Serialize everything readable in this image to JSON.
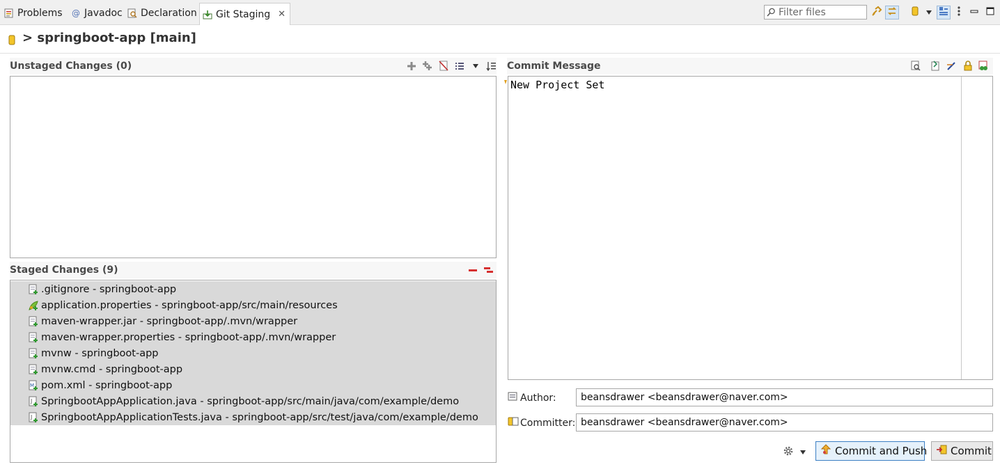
{
  "tabs": [
    {
      "label": "Problems",
      "icon": "problems-icon"
    },
    {
      "label": "Javadoc",
      "icon": "javadoc-icon"
    },
    {
      "label": "Declaration",
      "icon": "declaration-icon"
    },
    {
      "label": "Git Staging",
      "icon": "git-staging-icon",
      "active": true
    }
  ],
  "toolbar": {
    "filter_placeholder": "Filter files",
    "buttons": [
      "link-icon",
      "sync-icon",
      "repository-icon",
      "dropdown-icon",
      "layout-icon",
      "menu-icon",
      "minimize-icon",
      "maximize-icon"
    ]
  },
  "repo": {
    "title": "> springboot-app [main]"
  },
  "unstaged": {
    "title": "Unstaged Changes (0)",
    "items": []
  },
  "staged": {
    "title": "Staged Changes (9)",
    "items": [
      {
        "label": ".gitignore - springboot-app",
        "icon": "file-added-icon"
      },
      {
        "label": "application.properties - springboot-app/src/main/resources",
        "icon": "properties-file-icon"
      },
      {
        "label": "maven-wrapper.jar - springboot-app/.mvn/wrapper",
        "icon": "file-added-icon"
      },
      {
        "label": "maven-wrapper.properties - springboot-app/.mvn/wrapper",
        "icon": "file-added-icon"
      },
      {
        "label": "mvnw - springboot-app",
        "icon": "file-added-icon"
      },
      {
        "label": "mvnw.cmd - springboot-app",
        "icon": "file-added-icon"
      },
      {
        "label": "pom.xml - springboot-app",
        "icon": "xml-file-icon"
      },
      {
        "label": "SpringbootAppApplication.java - springboot-app/src/main/java/com/example/demo",
        "icon": "java-file-icon"
      },
      {
        "label": "SpringbootAppApplicationTests.java - springboot-app/src/test/java/com/example/demo",
        "icon": "java-file-icon"
      }
    ]
  },
  "commit": {
    "title": "Commit Message",
    "message": "New Project Set",
    "author_label": "Author:",
    "author_value": "beansdrawer <beansdrawer@naver.com>",
    "committer_label": "Committer:",
    "committer_value": "beansdrawer <beansdrawer@naver.com>",
    "commit_push_label": "Commit and Push",
    "commit_label": "Commit"
  },
  "colors": {
    "staged_row_bg": "#d9d9d9",
    "primary_button_border": "#3c7fc4",
    "section_title": "#4a4a4a"
  }
}
